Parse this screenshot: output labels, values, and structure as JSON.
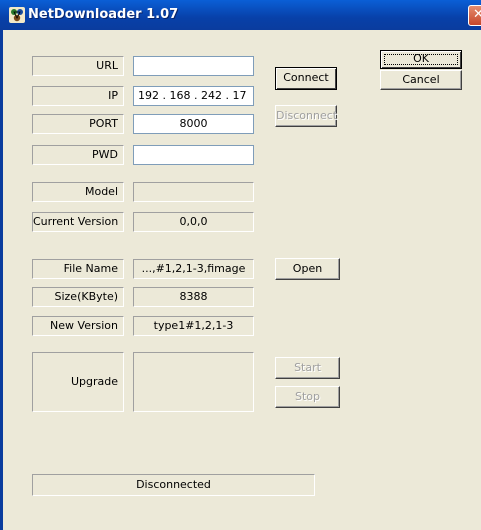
{
  "window": {
    "title": "NetDownloader 1.07",
    "icon": "network-app-icon",
    "close_glyph": "✕"
  },
  "connection": {
    "url_label": "URL",
    "url_value": "",
    "ip_label": "IP",
    "ip_value": "192 . 168 . 242 .  17",
    "port_label": "PORT",
    "port_value": "8000",
    "pwd_label": "PWD",
    "pwd_value": "",
    "connect_label": "Connect",
    "disconnect_label": "Disconnect"
  },
  "device": {
    "model_label": "Model",
    "model_value": "",
    "current_version_label": "Current Version",
    "current_version_value": "0,0,0"
  },
  "file": {
    "file_name_label": "File Name",
    "file_name_value": "...,#1,2,1-3,fimage",
    "open_label": "Open",
    "size_label": "Size(KByte)",
    "size_value": "8388",
    "new_version_label": "New Version",
    "new_version_value": "type1#1,2,1-3"
  },
  "upgrade": {
    "label": "Upgrade",
    "value": "",
    "start_label": "Start",
    "stop_label": "Stop"
  },
  "dialog_buttons": {
    "ok_label": "OK",
    "cancel_label": "Cancel"
  },
  "status": {
    "text": "Disconnected"
  },
  "colors": {
    "titlebar": "#0A5FD6",
    "dialog_background": "#ECE9D8",
    "disabled_text": "#A0A0A0"
  }
}
